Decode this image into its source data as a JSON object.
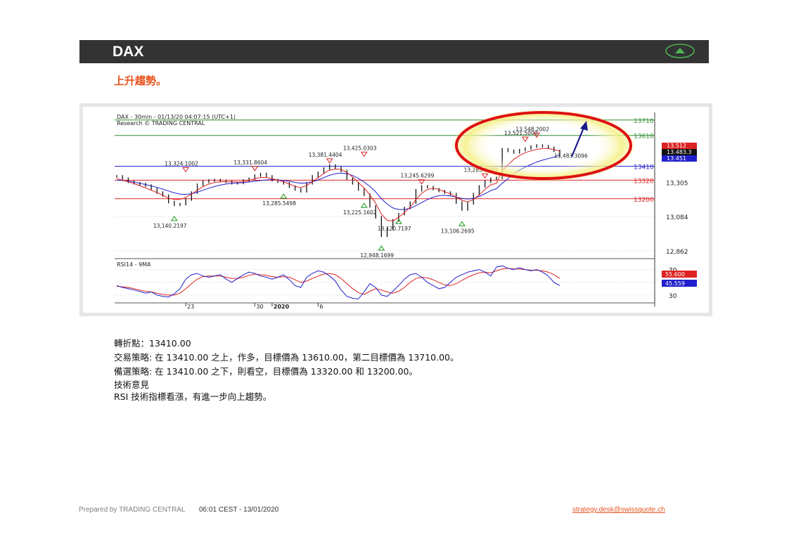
{
  "header": {
    "title": "DAX",
    "trend_icon": "up-triangle-icon",
    "accent_color": "#4caf50"
  },
  "subtitle": "上升趨勢。",
  "chart_data": {
    "type": "line",
    "title": "DAX - 30min - 01/13/20 04:07:15 (UTC+1)",
    "subtitle": "Research © TRADING CENTRAL",
    "x_ticks": [
      "23",
      "30",
      "2020",
      "6"
    ],
    "price_panel": {
      "y_ticks": [
        13305,
        13084,
        12862
      ],
      "ylim": [
        12830,
        13750
      ],
      "levels": [
        {
          "value": 13710,
          "label": "13710",
          "color": "#2e8b2e"
        },
        {
          "value": 13610,
          "label": "13610",
          "color": "#2e8b2e"
        },
        {
          "value": 13410,
          "label": "13410",
          "color": "#1f1fcc"
        },
        {
          "value": 13320,
          "label": "13320",
          "color": "#dd2222"
        },
        {
          "value": 13200,
          "label": "13200",
          "color": "#dd2222"
        }
      ],
      "current_price_tags": [
        {
          "label": "13.512",
          "color": "#dd2222"
        },
        {
          "label": "13.483.3",
          "color": "#111111"
        },
        {
          "label": "13.451",
          "color": "#1f1fcc"
        }
      ],
      "annotations": [
        {
          "label": "13,324.1002",
          "value": 13324.1002,
          "type": "high"
        },
        {
          "label": "13,331.8604",
          "value": 13331.8604,
          "type": "high"
        },
        {
          "label": "13,381.4404",
          "value": 13381.4404,
          "type": "high"
        },
        {
          "label": "13,425.0303",
          "value": 13425.0303,
          "type": "high"
        },
        {
          "label": "13,245.6299",
          "value": 13245.6299,
          "type": "high"
        },
        {
          "label": "13,283.8799",
          "value": 13283.8799,
          "type": "high"
        },
        {
          "label": "13,521.5000",
          "value": 13521.5,
          "type": "high"
        },
        {
          "label": "13,548.2002",
          "value": 13548.2002,
          "type": "high"
        },
        {
          "label": "13,285.5498",
          "value": 13285.5498,
          "type": "low"
        },
        {
          "label": "13,225.1602",
          "value": 13225.1602,
          "type": "low"
        },
        {
          "label": "13,140.2197",
          "value": 13140.2197,
          "type": "low"
        },
        {
          "label": "13,120.7197",
          "value": 13120.7197,
          "type": "low"
        },
        {
          "label": "12,948.1699",
          "value": 12948.1699,
          "type": "low"
        },
        {
          "label": "13,106.2695",
          "value": 13106.2695,
          "type": "low"
        },
        {
          "label": "13,483.3096",
          "value": 13483.3096,
          "type": "ma"
        }
      ],
      "series": {
        "price": [
          13345,
          13330,
          13310,
          13300,
          13295,
          13285,
          13262,
          13240,
          13220,
          13178,
          13160,
          13165,
          13195,
          13240,
          13290,
          13310,
          13318,
          13320,
          13315,
          13310,
          13300,
          13302,
          13318,
          13330,
          13350,
          13360,
          13345,
          13320,
          13310,
          13300,
          13278,
          13260,
          13248,
          13300,
          13345,
          13368,
          13395,
          13415,
          13400,
          13380,
          13330,
          13300,
          13260,
          13226,
          13150,
          13080,
          12960,
          13005,
          13060,
          13100,
          13140,
          13175,
          13255,
          13280,
          13275,
          13262,
          13250,
          13240,
          13230,
          13175,
          13130,
          13170,
          13230,
          13280,
          13310,
          13330,
          13335,
          13520,
          13510,
          13500,
          13515,
          13525,
          13538,
          13545,
          13540,
          13530,
          13510,
          13480
        ],
        "ma_red": [
          13330,
          13320,
          13310,
          13298,
          13285,
          13270,
          13255,
          13240,
          13222,
          13205,
          13195,
          13195,
          13208,
          13230,
          13255,
          13278,
          13295,
          13305,
          13310,
          13310,
          13310,
          13308,
          13310,
          13318,
          13330,
          13338,
          13338,
          13330,
          13320,
          13310,
          13295,
          13280,
          13272,
          13285,
          13310,
          13335,
          13365,
          13385,
          13392,
          13390,
          13370,
          13340,
          13305,
          13270,
          13225,
          13170,
          13100,
          13060,
          13055,
          13080,
          13110,
          13145,
          13195,
          13235,
          13260,
          13268,
          13260,
          13245,
          13232,
          13210,
          13190,
          13180,
          13195,
          13225,
          13260,
          13290,
          13300,
          13380,
          13420,
          13455,
          13480,
          13498,
          13510,
          13520,
          13525,
          13525,
          13518,
          13508
        ],
        "ma_blue": [
          13320,
          13318,
          13314,
          13308,
          13300,
          13292,
          13283,
          13273,
          13262,
          13250,
          13238,
          13230,
          13228,
          13232,
          13242,
          13255,
          13268,
          13279,
          13288,
          13295,
          13300,
          13302,
          13304,
          13308,
          13313,
          13318,
          13322,
          13324,
          13322,
          13318,
          13313,
          13306,
          13300,
          13302,
          13310,
          13322,
          13337,
          13352,
          13362,
          13366,
          13362,
          13350,
          13332,
          13308,
          13280,
          13245,
          13200,
          13165,
          13140,
          13130,
          13130,
          13138,
          13155,
          13175,
          13195,
          13210,
          13220,
          13222,
          13218,
          13210,
          13202,
          13198,
          13202,
          13215,
          13232,
          13252,
          13265,
          13300,
          13330,
          13360,
          13385,
          13405,
          13422,
          13438,
          13450,
          13460,
          13470,
          13483
        ]
      }
    },
    "rsi_panel": {
      "title": "RSI14 - 9MA",
      "y_ticks": [
        70,
        50,
        30
      ],
      "ylim": [
        20,
        85
      ],
      "current_tags": [
        {
          "label": "55.600",
          "color": "#dd2222"
        },
        {
          "label": "45.559",
          "color": "#1f1fcc"
        }
      ],
      "series": {
        "rsi": [
          45,
          42,
          40,
          38,
          36,
          33,
          35,
          30,
          28,
          27,
          32,
          40,
          55,
          62,
          64,
          60,
          58,
          60,
          62,
          55,
          50,
          56,
          62,
          66,
          64,
          60,
          58,
          55,
          58,
          62,
          54,
          45,
          42,
          58,
          64,
          68,
          66,
          60,
          52,
          38,
          28,
          25,
          24,
          35,
          48,
          42,
          30,
          28,
          36,
          45,
          55,
          62,
          64,
          58,
          50,
          45,
          40,
          42,
          50,
          58,
          62,
          66,
          68,
          70,
          66,
          60,
          74,
          76,
          72,
          70,
          73,
          70,
          68,
          70,
          66,
          60,
          50,
          45
        ],
        "ma": [
          44,
          43,
          42,
          40,
          38,
          36,
          35,
          33,
          31,
          30,
          30,
          33,
          40,
          48,
          55,
          59,
          60,
          60,
          60,
          58,
          56,
          56,
          58,
          61,
          63,
          62,
          61,
          59,
          58,
          59,
          58,
          54,
          50,
          52,
          56,
          60,
          63,
          64,
          62,
          56,
          48,
          40,
          34,
          31,
          36,
          40,
          38,
          35,
          33,
          36,
          42,
          50,
          56,
          58,
          57,
          54,
          50,
          46,
          45,
          48,
          53,
          58,
          62,
          65,
          66,
          65,
          68,
          71,
          72,
          71,
          71,
          70,
          69,
          69,
          68,
          66,
          62,
          56
        ]
      }
    },
    "projection_arrow": "up",
    "highlight_color": "#dd1111"
  },
  "notes": {
    "pivot": "轉折點：13410.00",
    "strategy": "交易策略: 在 13410.00 之上，作多，目標價為  13610.00，第二目標價為 13710.00。",
    "alternative": "備選策略: 在 13410.00 之下，則看空，目標價為  13320.00 和 13200.00。",
    "comment_title": "技術意見",
    "comment": "RSI 技術指標看漲，有進一步向上趨勢。"
  },
  "footer": {
    "prepared_by": "Prepared by TRADING CENTRAL",
    "timestamp": "06:01 CEST - 13/01/2020",
    "email": "strategy.desk@swissquote.ch"
  }
}
